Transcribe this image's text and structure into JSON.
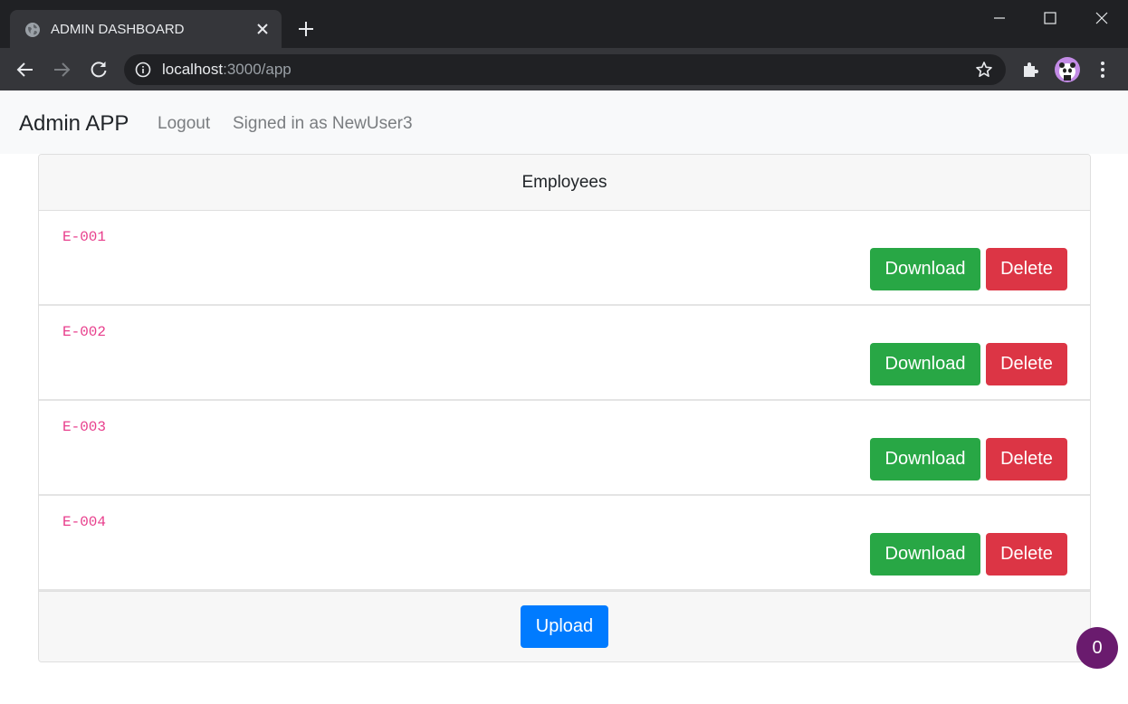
{
  "browser": {
    "tab_title": "ADMIN DASHBOARD",
    "url_host": "localhost",
    "url_rest": ":3000/app"
  },
  "navbar": {
    "brand": "Admin APP",
    "logout": "Logout",
    "signed_in": "Signed in as NewUser3"
  },
  "card": {
    "header": "Employees",
    "rows": [
      {
        "id": "E-001",
        "download": "Download",
        "delete": "Delete"
      },
      {
        "id": "E-002",
        "download": "Download",
        "delete": "Delete"
      },
      {
        "id": "E-003",
        "download": "Download",
        "delete": "Delete"
      },
      {
        "id": "E-004",
        "download": "Download",
        "delete": "Delete"
      }
    ],
    "upload": "Upload"
  },
  "badge": {
    "count": "0"
  },
  "colors": {
    "download": "#28a745",
    "delete": "#dc3545",
    "upload": "#007bff",
    "id_text": "#e83e8c",
    "badge": "#6a1b6e"
  }
}
